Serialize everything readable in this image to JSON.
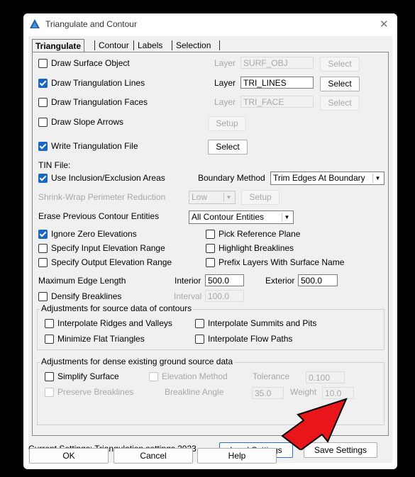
{
  "window": {
    "title": "Triangulate and Contour",
    "close_glyph": "✕"
  },
  "tabs": [
    "Triangulate",
    "Contour",
    "Labels",
    "Selection"
  ],
  "rows": {
    "draw_surface_object": {
      "label": "Draw Surface Object",
      "checked": false,
      "layer_label": "Layer",
      "layer_value": "SURF_OBJ",
      "button": "Select"
    },
    "draw_triangulation_lines": {
      "label": "Draw Triangulation Lines",
      "checked": true,
      "layer_label": "Layer",
      "layer_value": "TRI_LINES",
      "button": "Select"
    },
    "draw_triangulation_faces": {
      "label": "Draw Triangulation Faces",
      "checked": false,
      "layer_label": "Layer",
      "layer_value": "TRI_FACE",
      "button": "Select"
    },
    "draw_slope_arrows": {
      "label": "Draw Slope Arrows",
      "checked": false,
      "button": "Setup"
    },
    "write_triangulation_file": {
      "label": "Write Triangulation File",
      "checked": true,
      "button": "Select"
    }
  },
  "tin_file_label": "TIN File:",
  "inclusion": {
    "label": "Use Inclusion/Exclusion Areas",
    "checked": true,
    "boundary_label": "Boundary Method",
    "boundary_value": "Trim Edges At Boundary"
  },
  "shrink_wrap": {
    "label": "Shrink-Wrap Perimeter Reduction",
    "value": "Low",
    "button": "Setup"
  },
  "erase": {
    "label": "Erase Previous Contour Entities",
    "value": "All Contour Entities"
  },
  "options_left": [
    {
      "label": "Ignore Zero Elevations",
      "checked": true
    },
    {
      "label": "Specify Input Elevation Range",
      "checked": false
    },
    {
      "label": "Specify Output Elevation Range",
      "checked": false
    }
  ],
  "options_right": [
    {
      "label": "Pick Reference Plane",
      "checked": false
    },
    {
      "label": "Highlight Breaklines",
      "checked": false
    },
    {
      "label": "Prefix Layers With Surface Name",
      "checked": false
    }
  ],
  "edge_length": {
    "label": "Maximum Edge Length",
    "interior_label": "Interior",
    "interior_value": "500.0",
    "exterior_label": "Exterior",
    "exterior_value": "500.0"
  },
  "densify": {
    "label": "Densify Breaklines",
    "checked": false,
    "interval_label": "Interval",
    "interval_value": "100.0"
  },
  "contour_adjust": {
    "title": "Adjustments for source data of contours",
    "items": [
      {
        "label": "Interpolate Ridges and Valleys",
        "checked": false
      },
      {
        "label": "Interpolate Summits and Pits",
        "checked": false
      },
      {
        "label": "Minimize Flat Triangles",
        "checked": false
      },
      {
        "label": "Interpolate Flow Paths",
        "checked": false
      }
    ]
  },
  "dense_adjust": {
    "title": "Adjustments for dense existing ground source data",
    "simplify": {
      "label": "Simplify Surface",
      "checked": false
    },
    "elevation_method": {
      "label": "Elevation Method",
      "checked": false
    },
    "tolerance_label": "Tolerance",
    "tolerance_value": "0.100",
    "preserve": {
      "label": "Preserve Breaklines",
      "checked": false
    },
    "angle_label": "Breakline Angle",
    "angle_value": "35.0",
    "weight_label": "Weight",
    "weight_value": "10.0"
  },
  "footer": {
    "current_settings": "Current Settings: Triangulation settings 2023",
    "load": "Load Settings",
    "save": "Save Settings",
    "ok": "OK",
    "cancel": "Cancel",
    "help": "Help"
  },
  "colors": {
    "accent": "#1867c6",
    "annotation_arrow": "#e8151b"
  },
  "icons": {
    "app": "app-logo-icon",
    "close": "close-icon",
    "annotation": "red-arrow-annotation"
  }
}
